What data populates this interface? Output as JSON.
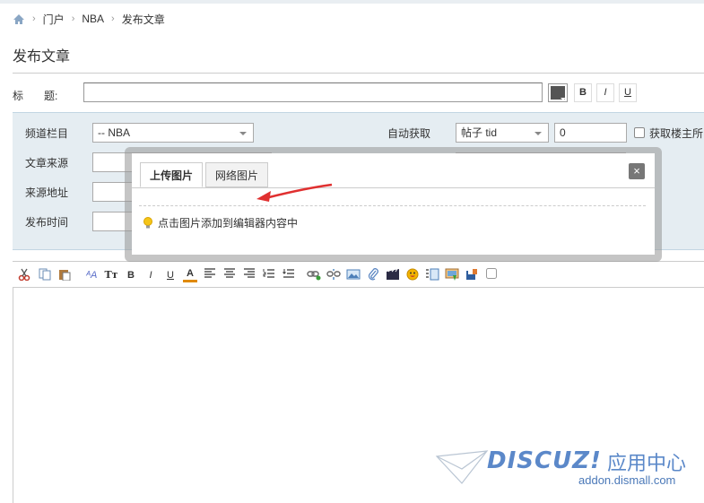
{
  "breadcrumb": {
    "items": [
      "门户",
      "NBA",
      "发布文章"
    ]
  },
  "page_title": "发布文章",
  "title_field": {
    "label_a": "标",
    "label_b": "题:",
    "value": ""
  },
  "format_buttons": {
    "bold": "B",
    "italic": "I",
    "underline": "U"
  },
  "form": {
    "channel_label": "频道栏目",
    "channel_value": "-- NBA",
    "source_label": "文章来源",
    "source_url_label": "来源地址",
    "publish_time_label": "发布时间",
    "auto_fetch_label": "自动获取",
    "fetch_type_value": "帖子 tid",
    "fetch_id_value": "0",
    "fetch_owner_label": "获取楼主所"
  },
  "toolbar": {
    "bold": "B",
    "italic": "I",
    "underline": "U",
    "fontcolor": "A",
    "fontsize": "Tт",
    "font": "ᴬA"
  },
  "dialog": {
    "tab_upload": "上传图片",
    "tab_web": "网络图片",
    "close": "×",
    "tip": "点击图片添加到编辑器内容中"
  },
  "watermark": {
    "logo": "DISCUZ!",
    "cn": "应用中心",
    "url": "addon.dismall.com"
  },
  "colors": {
    "panel_bg": "#e5edf2",
    "accent": "#5b88c9",
    "arrow": "#e03030"
  }
}
